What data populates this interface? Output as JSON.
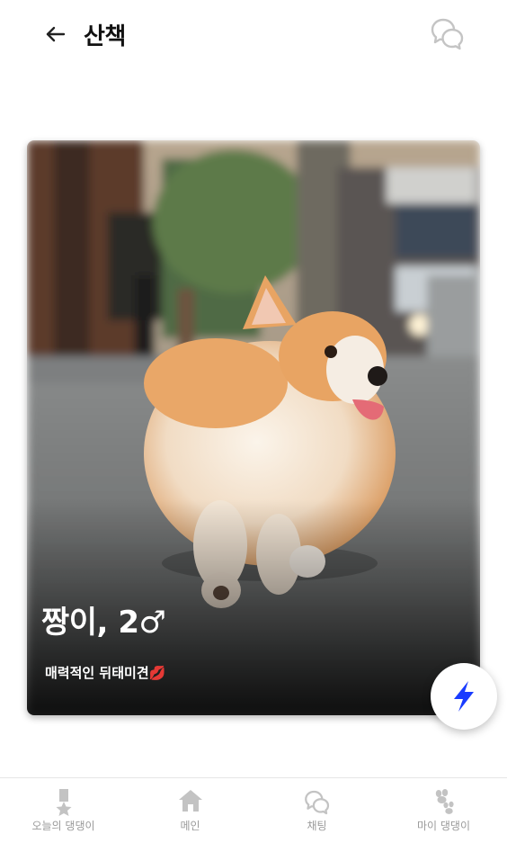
{
  "header": {
    "title": "산책",
    "back_icon": "arrow-left-icon",
    "chat_icon": "chat-bubbles-icon"
  },
  "card": {
    "name_line": "짱이, 2♂",
    "description": "매력적인 뒤태미견💋",
    "photo": "corgi walking on a city street, viewed from behind"
  },
  "fab": {
    "icon": "lightning-icon",
    "color": "#1a3cff"
  },
  "bottom_nav": {
    "items": [
      {
        "label": "오늘의 댕댕이",
        "icon": "medal-icon"
      },
      {
        "label": "메인",
        "icon": "home-icon"
      },
      {
        "label": "채팅",
        "icon": "chat-bubbles-icon"
      },
      {
        "label": "마이 댕댕이",
        "icon": "paw-icon"
      }
    ],
    "inactive_color": "#b8b8b8"
  }
}
